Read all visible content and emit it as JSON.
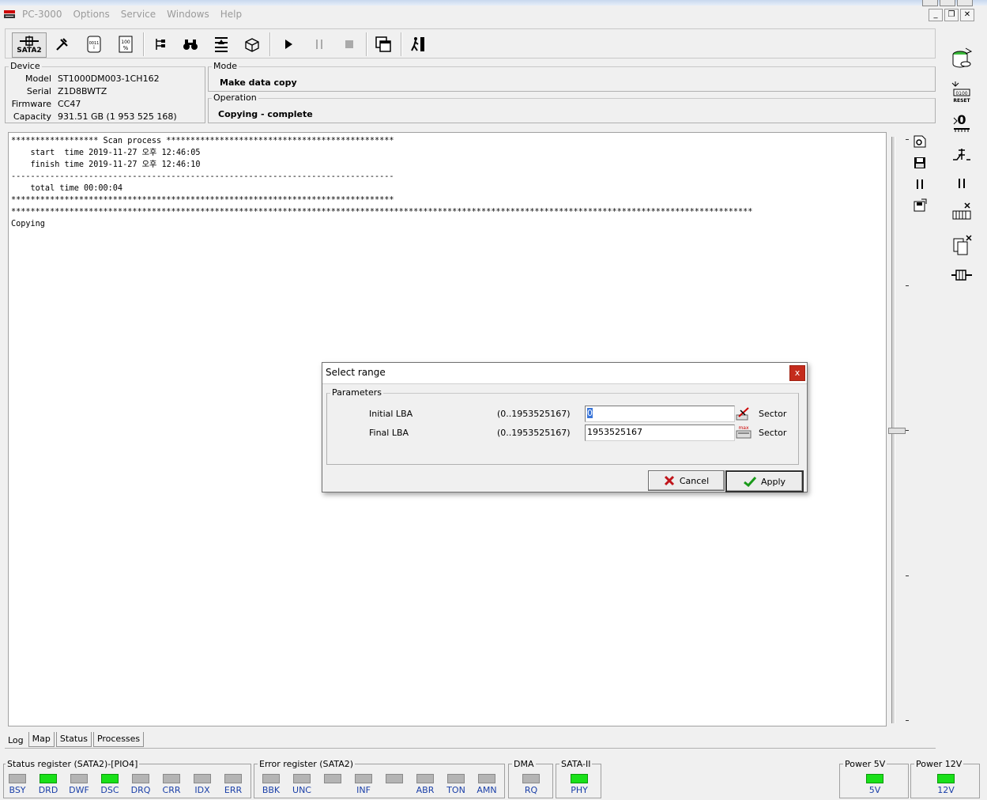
{
  "app": {
    "title": "PC-3000",
    "menu": [
      "Options",
      "Service",
      "Windows",
      "Help"
    ]
  },
  "toolbar": {
    "sata_label": "SATA2",
    "icons": [
      "sata-port-icon",
      "tools-icon",
      "scroll-icon",
      "percent-icon",
      "tree-icon",
      "binoculars-icon",
      "stack-icon",
      "box-icon",
      "play-icon",
      "pause-icon",
      "stop-icon",
      "copy-window-icon",
      "exit-icon"
    ]
  },
  "device": {
    "title": "Device",
    "rows": [
      {
        "key": "Model",
        "value": "ST1000DM003-1CH162"
      },
      {
        "key": "Serial",
        "value": "Z1D8BWTZ"
      },
      {
        "key": "Firmware",
        "value": "CC47"
      },
      {
        "key": "Capacity",
        "value": "931.51 GB (1 953 525 168)"
      }
    ]
  },
  "mode": {
    "title": "Mode",
    "value": "Make data copy"
  },
  "operation": {
    "title": "Operation",
    "value": "Copying - complete"
  },
  "log": {
    "lines": [
      "****************** Scan process ***********************************************",
      "    start  time 2019-11-27 오후 12:46:05",
      "    finish time 2019-11-27 오후 12:46:10",
      "-------------------------------------------------------------------------------",
      "    total time 00:00:04",
      "*******************************************************************************",
      "*********************************************************************************************************************************************************",
      "Copying"
    ]
  },
  "tabs": [
    "Log",
    "Map",
    "Status",
    "Processes"
  ],
  "status_register": {
    "title": "Status register (SATA2)-[PIO4]",
    "leds": [
      {
        "label": "BSY",
        "on": false
      },
      {
        "label": "DRD",
        "on": true
      },
      {
        "label": "DWF",
        "on": false
      },
      {
        "label": "DSC",
        "on": true
      },
      {
        "label": "DRQ",
        "on": false
      },
      {
        "label": "CRR",
        "on": false
      },
      {
        "label": "IDX",
        "on": false
      },
      {
        "label": "ERR",
        "on": false
      }
    ]
  },
  "error_register": {
    "title": "Error register (SATA2)",
    "leds": [
      {
        "label": "BBK",
        "on": false
      },
      {
        "label": "UNC",
        "on": false
      },
      {
        "label": "",
        "on": false
      },
      {
        "label": "INF",
        "on": false
      },
      {
        "label": "",
        "on": false
      },
      {
        "label": "ABR",
        "on": false
      },
      {
        "label": "TON",
        "on": false
      },
      {
        "label": "AMN",
        "on": false
      }
    ]
  },
  "dma": {
    "title": "DMA",
    "led": {
      "label": "RQ",
      "on": false
    }
  },
  "sata2": {
    "title": "SATA-II",
    "led": {
      "label": "PHY",
      "on": true
    }
  },
  "power5": {
    "title": "Power 5V",
    "led": {
      "label": "5V",
      "on": true
    }
  },
  "power12": {
    "title": "Power 12V",
    "led": {
      "label": "12V",
      "on": true
    }
  },
  "dialog": {
    "title": "Select range",
    "close": "x",
    "group": "Parameters",
    "rows": [
      {
        "label": "Initial LBA",
        "range": "(0..1953525167)",
        "value": "0",
        "unit": "Sector"
      },
      {
        "label": "Final  LBA",
        "range": "(0..1953525167)",
        "value": "1953525167",
        "unit": "Sector"
      }
    ],
    "max_label": "max",
    "cancel": "Cancel",
    "apply": "Apply"
  },
  "colors": {
    "led_on": "#19e019",
    "led_off": "#b4b4b4",
    "led_label": "#1a3fa8",
    "close_red": "#c42b1c"
  }
}
